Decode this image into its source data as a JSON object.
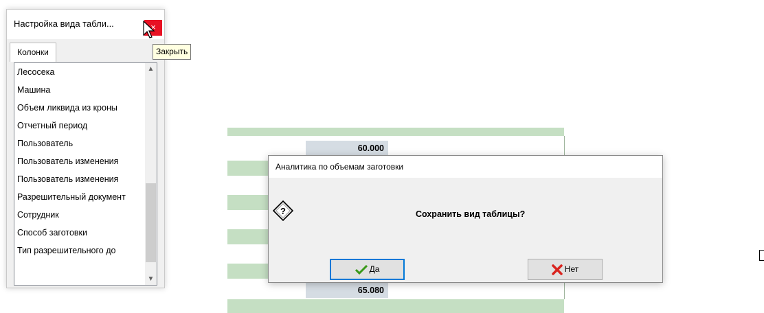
{
  "settings_window": {
    "title": "Настройка вида табли...",
    "close_tooltip": "Закрыть",
    "tabs": [
      {
        "label": "Колонки"
      }
    ],
    "columns": [
      "Лесосека",
      "Машина",
      "Объем ликвида из кроны",
      "Отчетный период",
      "Пользователь",
      "Пользователь изменения",
      "Пользователь изменения",
      "Разрешительный документ",
      "Сотрудник",
      "Способ заготовки",
      "Тип разрешительного до"
    ]
  },
  "grid": {
    "values": [
      "60.000",
      "65.080"
    ]
  },
  "dialog": {
    "title": "Аналитика по объемам заготовки",
    "message": "Сохранить вид таблицы?",
    "icon": "question-icon",
    "yes_label": "Да",
    "no_label": "Нет"
  },
  "colors": {
    "close_button": "#e81123",
    "grid_band": "#c5dfc3",
    "focus_border": "#0078d7",
    "tooltip_bg": "#ffffe1"
  }
}
